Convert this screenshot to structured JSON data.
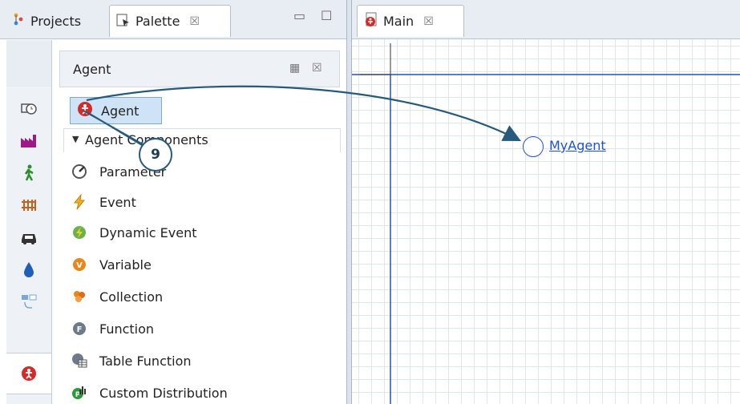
{
  "left_tabs": [
    {
      "label": "Projects",
      "icon": "projects-icon"
    },
    {
      "label": "Palette",
      "icon": "palette-icon",
      "close": "☒"
    }
  ],
  "left_window_controls": {
    "minimize": "▭",
    "maximize": "☐"
  },
  "strip_icons": [
    "clock-icon",
    "factory-icon",
    "pedestrian-icon",
    "rail-icon",
    "car-icon",
    "fluid-drop-icon",
    "process-icon",
    "agent-icon"
  ],
  "palette": {
    "title": "Agent",
    "agent_item": "Agent",
    "section": "Agent Components",
    "items": [
      {
        "label": "Parameter",
        "icon": "parameter-icon"
      },
      {
        "label": "Event",
        "icon": "event-icon"
      },
      {
        "label": "Dynamic Event",
        "icon": "dynamic-event-icon"
      },
      {
        "label": "Variable",
        "icon": "variable-icon"
      },
      {
        "label": "Collection",
        "icon": "collection-icon"
      },
      {
        "label": "Function",
        "icon": "function-icon"
      },
      {
        "label": "Table Function",
        "icon": "table-function-icon"
      },
      {
        "label": "Custom Distribution",
        "icon": "custom-distribution-icon"
      }
    ]
  },
  "right_tab": {
    "label": "Main",
    "close": "☒"
  },
  "canvas": {
    "agent_label": "MyAgent"
  },
  "step": {
    "number": "9"
  },
  "colors": {
    "accent": "#1a53d6",
    "arrow": "#255a7d",
    "selection": "#cfe3f7"
  }
}
